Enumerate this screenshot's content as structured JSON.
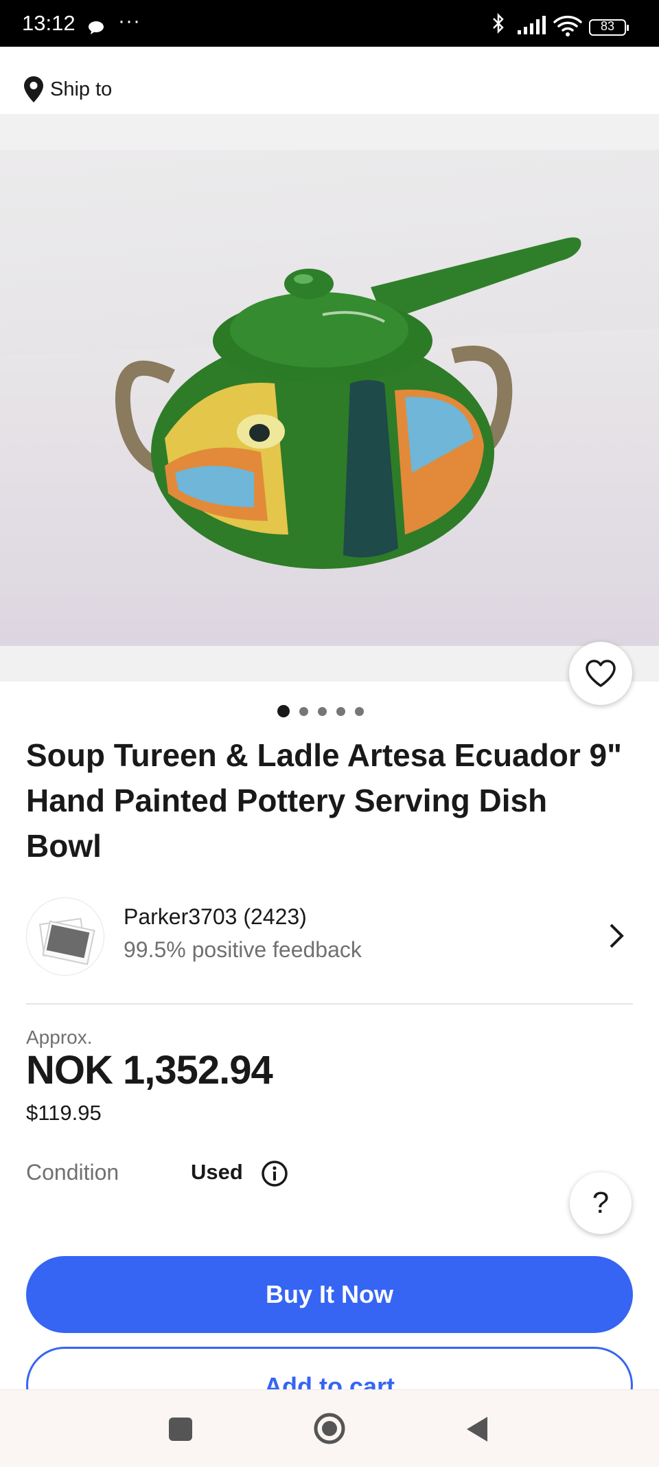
{
  "status_bar": {
    "time": "13:12",
    "more": "···",
    "battery": "83"
  },
  "header": {
    "ship_to": "Ship to"
  },
  "gallery": {
    "total_images": 5,
    "active_index": 0
  },
  "listing": {
    "title": "Soup Tureen & Ladle Artesa Ecuador 9\" Hand Painted Pottery Serving Dish Bowl",
    "seller_name": "Parker3703 (2423)",
    "seller_feedback": "99.5% positive feedback",
    "approx_label": "Approx.",
    "price_local": "NOK 1,352.94",
    "price_usd": "$119.95",
    "condition_label": "Condition",
    "condition_value": "Used",
    "help_label": "?"
  },
  "actions": {
    "buy_now": "Buy It Now",
    "add_to_cart": "Add to cart"
  },
  "colors": {
    "accent": "#3665f3",
    "text": "#191919",
    "muted": "#707070"
  }
}
